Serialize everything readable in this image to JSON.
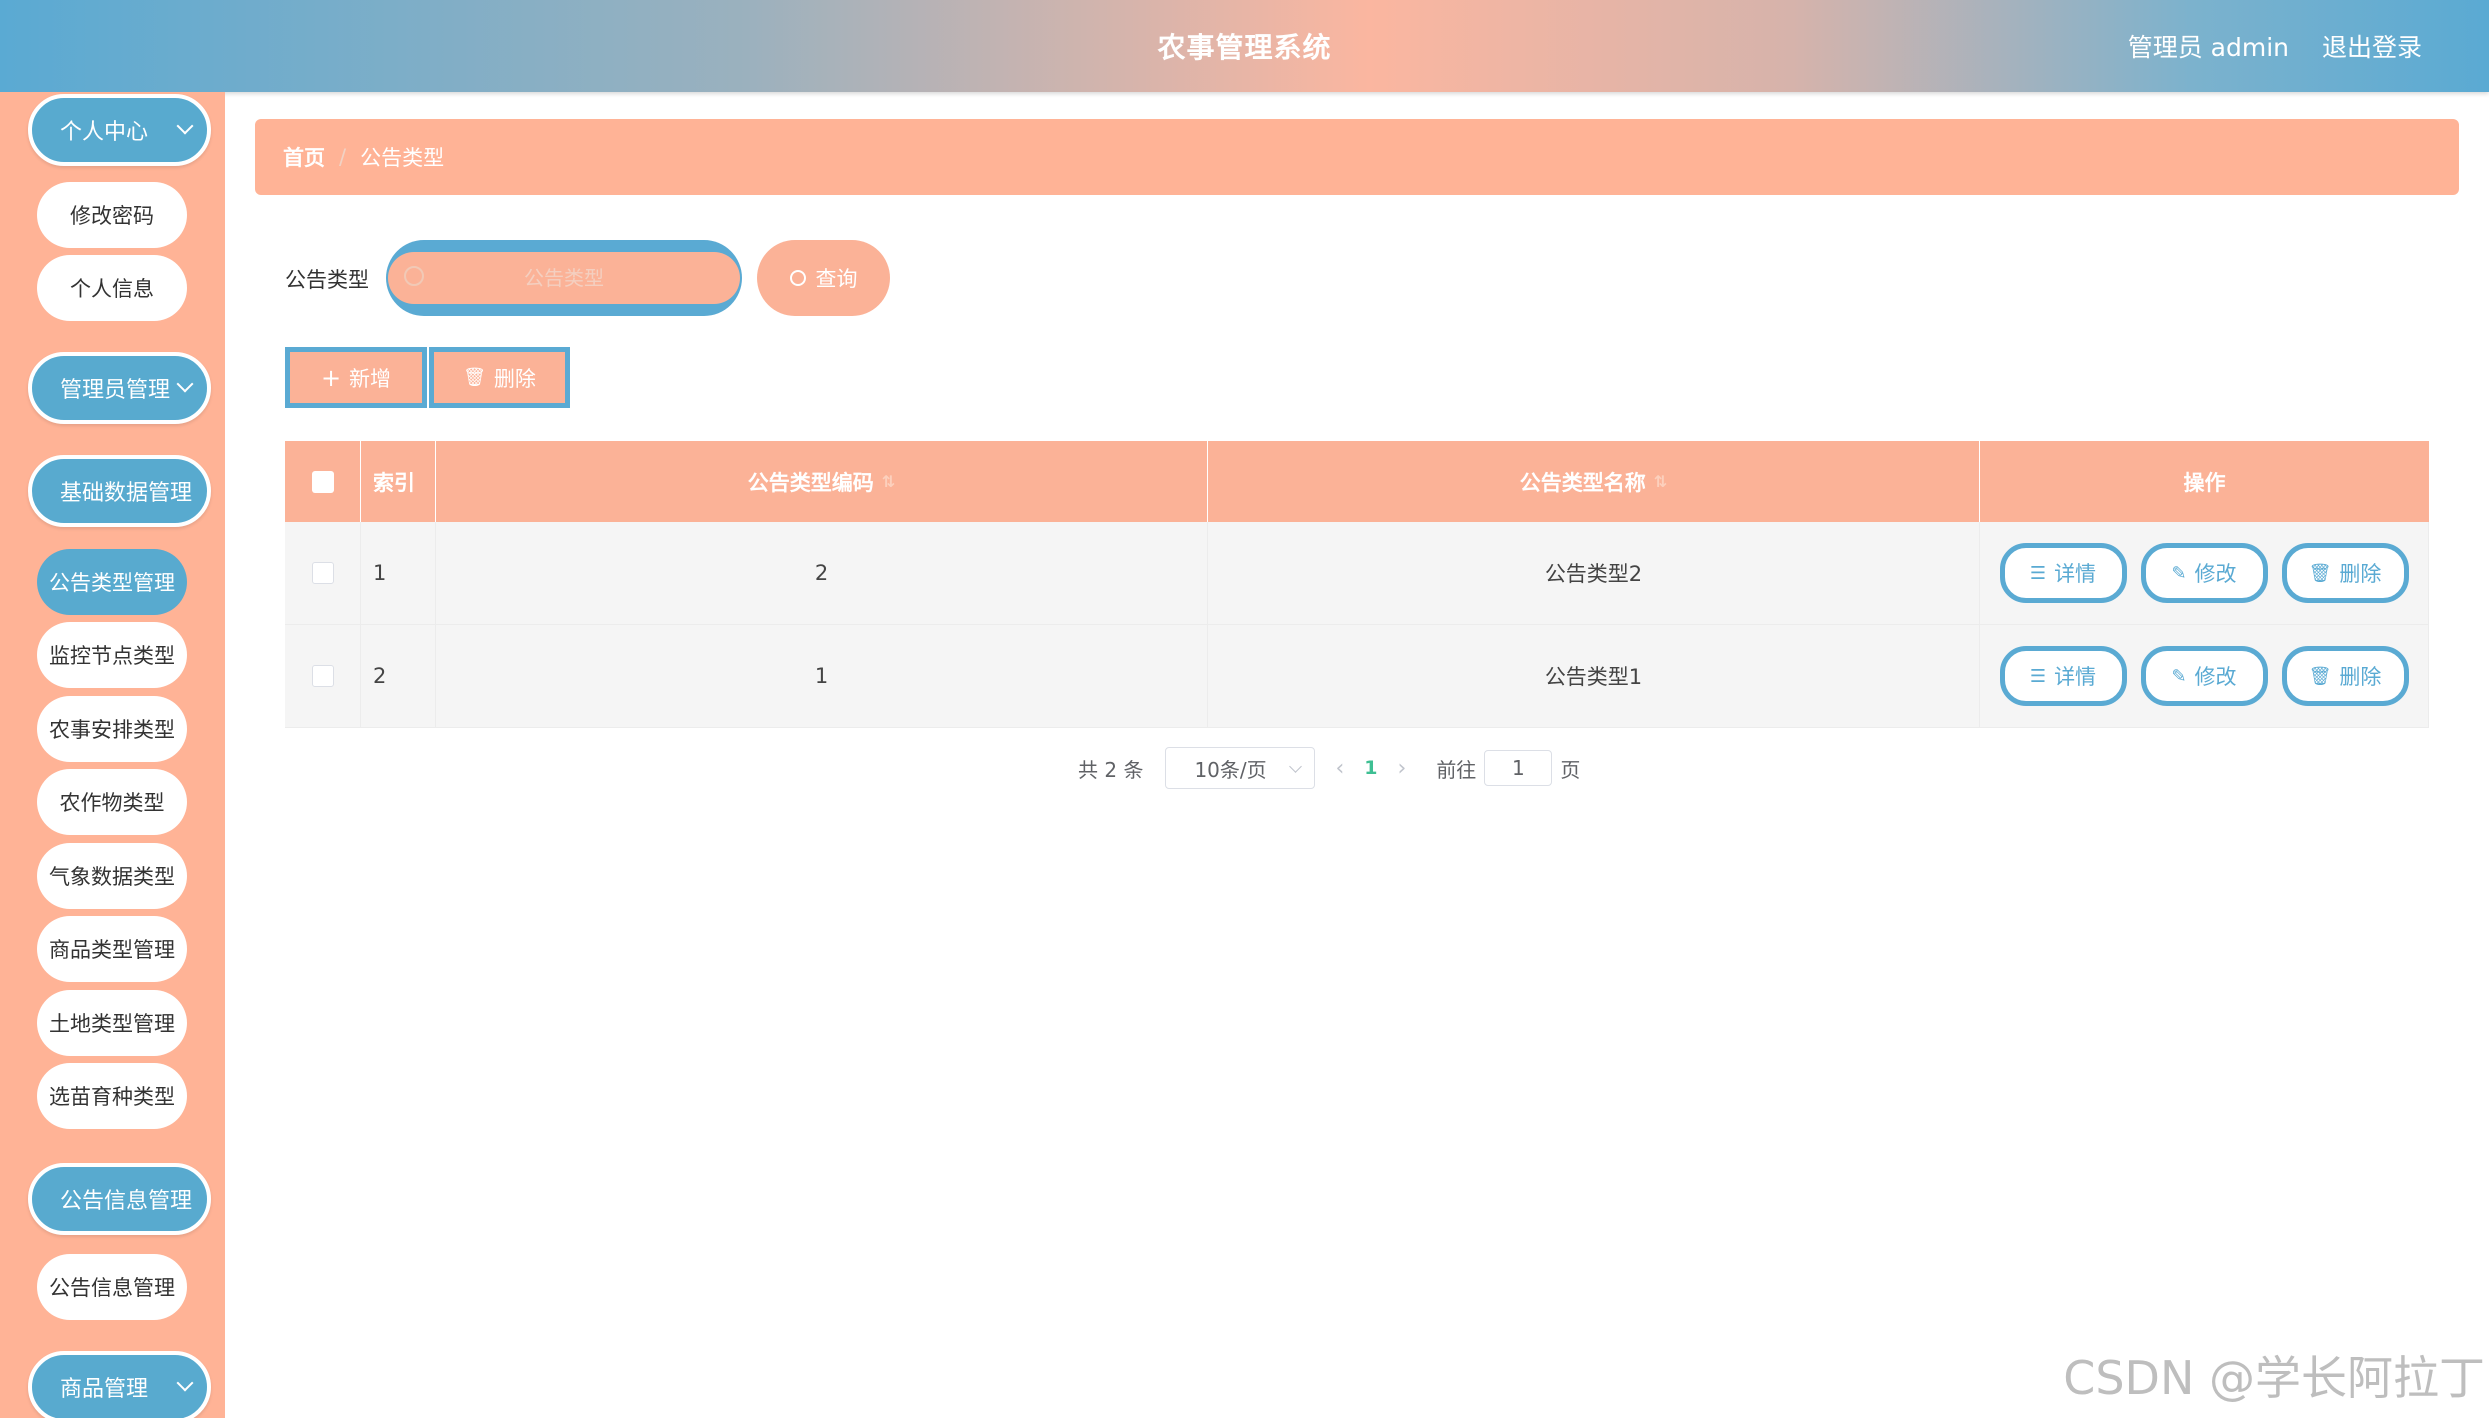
{
  "header": {
    "title": "农事管理系统",
    "user": "管理员 admin",
    "logout": "退出登录"
  },
  "sidebar": {
    "groups": [
      {
        "label": "个人中心",
        "items": [
          "修改密码",
          "个人信息"
        ]
      },
      {
        "label": "管理员管理",
        "items": []
      },
      {
        "label": "基础数据管理",
        "items": [
          "公告类型管理",
          "监控节点类型",
          "农事安排类型",
          "农作物类型",
          "气象数据类型",
          "商品类型管理",
          "土地类型管理",
          "选苗育种类型"
        ]
      },
      {
        "label": "公告信息管理",
        "items": [
          "公告信息管理"
        ]
      },
      {
        "label": "商品管理",
        "items": []
      }
    ]
  },
  "breadcrumb": {
    "home": "首页",
    "sep": "/",
    "current": "公告类型"
  },
  "search": {
    "label": "公告类型",
    "placeholder": "公告类型",
    "button": "查询"
  },
  "actions": {
    "add": "新增",
    "delete": "删除"
  },
  "table": {
    "headers": {
      "index": "索引",
      "code": "公告类型编码",
      "name": "公告类型名称",
      "ops": "操作"
    },
    "rows": [
      {
        "index": "1",
        "code": "2",
        "name": "公告类型2"
      },
      {
        "index": "2",
        "code": "1",
        "name": "公告类型1"
      }
    ],
    "ops": {
      "detail": "详情",
      "edit": "修改",
      "delete": "删除"
    }
  },
  "pagination": {
    "total": "共 2 条",
    "page_size": "10条/页",
    "current_page": "1",
    "goto_label": "前往",
    "goto_value": "1",
    "page_unit": "页"
  },
  "watermark": "CSDN @学长阿拉丁",
  "colors": {
    "accent_blue": "#58aacf",
    "accent_peach": "#ffb396"
  }
}
